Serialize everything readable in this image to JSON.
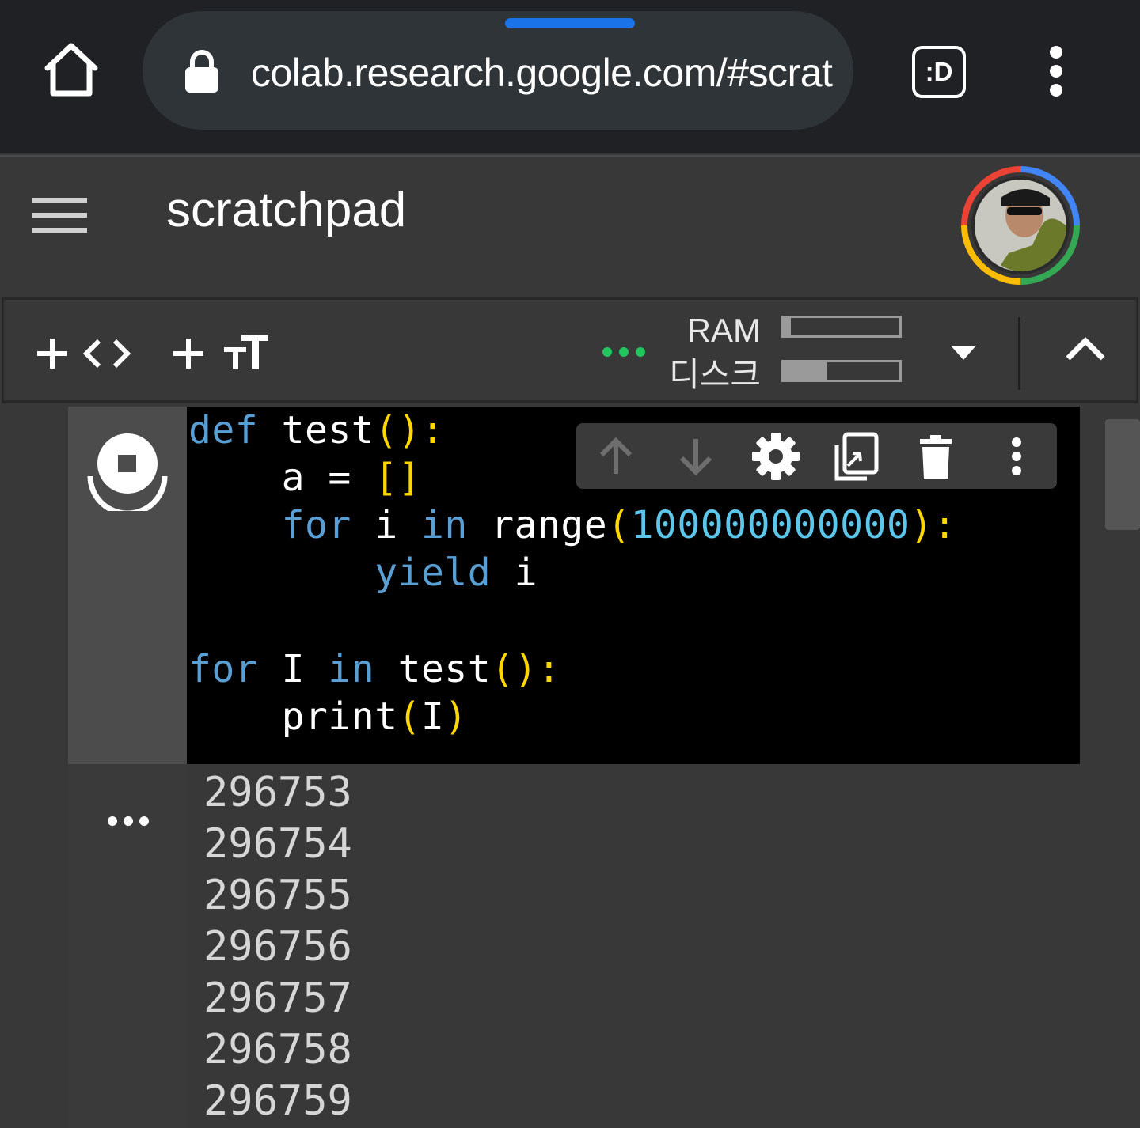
{
  "browser": {
    "url": "colab.research.google.com/#scratchpad",
    "tabs_label": ":D",
    "accent_color": "#1a73e8"
  },
  "header": {
    "title": "scratchpad",
    "avatar_icon": "user-avatar"
  },
  "toolbar": {
    "add_code_icon": "plus-code-icon",
    "add_text_icon": "plus-text-icon",
    "status_dots_color": "#22c55e",
    "ram_label": "RAM",
    "disk_label": "디스크",
    "ram_usage": 0.06,
    "disk_usage": 0.38
  },
  "cell": {
    "code_lines": [
      "def test():",
      "    a = []",
      "    for i in range(100000000000):",
      "        yield i",
      "",
      "for I in test():",
      "    print(I)"
    ],
    "toolbar_icons": [
      "arrow-up-icon",
      "arrow-down-icon",
      "gear-icon",
      "copy-link-icon",
      "trash-icon",
      "more-vert-icon"
    ]
  },
  "output": {
    "lines": [
      "296753",
      "296754",
      "296755",
      "296756",
      "296757",
      "296758",
      "296759"
    ]
  }
}
